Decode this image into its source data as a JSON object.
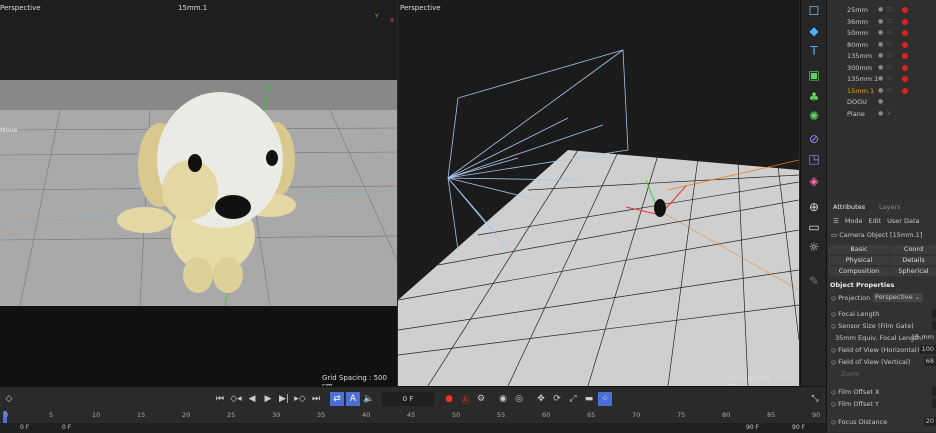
{
  "viewport_left": {
    "label": "Perspective",
    "camera": "15mm.1",
    "move_label": "Move",
    "grid_spacing": "Grid Spacing : 500 cm"
  },
  "viewport_right": {
    "label": "Perspective",
    "grid_spacing": "Grid Spacing : 500 cm"
  },
  "objects": [
    {
      "name": "25mm"
    },
    {
      "name": "36mm"
    },
    {
      "name": "50mm"
    },
    {
      "name": "80mm"
    },
    {
      "name": "135mm"
    },
    {
      "name": "300mm"
    },
    {
      "name": "135mm.1"
    },
    {
      "name": "15mm.1",
      "active": true
    },
    {
      "name": "DOGU"
    },
    {
      "name": "Plane"
    }
  ],
  "attributes": {
    "tabs": [
      "Attributes",
      "Layers"
    ],
    "menu": [
      "Mode",
      "Edit",
      "User Data"
    ],
    "object_title": "Camera Object [15mm.1]",
    "sections": [
      "Basic",
      "Coord",
      "Physical",
      "Details",
      "Composition",
      "Spherical"
    ],
    "header": "Object Properties",
    "projection_label": "Projection",
    "projection_value": "Perspective",
    "props": [
      {
        "label": "Focal Length",
        "value": ""
      },
      {
        "label": "Sensor Size (Film Gate)",
        "value": ""
      },
      {
        "label": "35mm Equiv. Focal Length:",
        "value": "15 mm"
      },
      {
        "label": "Field of View (Horizontal)",
        "value": "100"
      },
      {
        "label": "Field of View (Vertical)",
        "value": "68"
      },
      {
        "label": "Zoom",
        "value": ""
      },
      {
        "label": "Film Offset X",
        "value": ""
      },
      {
        "label": "Film Offset Y",
        "value": ""
      },
      {
        "label": "Focus Distance",
        "value": "20"
      }
    ]
  },
  "timeline": {
    "frame_field": "0 F",
    "ticks": [
      "0",
      "5",
      "10",
      "15",
      "20",
      "25",
      "30",
      "35",
      "40",
      "45",
      "50",
      "55",
      "60",
      "65",
      "70",
      "75",
      "80",
      "85",
      "90"
    ],
    "start": "0 F",
    "start2": "0 F",
    "end": "90 F",
    "end2": "90 F"
  },
  "colors": {
    "accent": "#4b6fd6",
    "record": "#d22",
    "active_object": "#f0a000"
  }
}
